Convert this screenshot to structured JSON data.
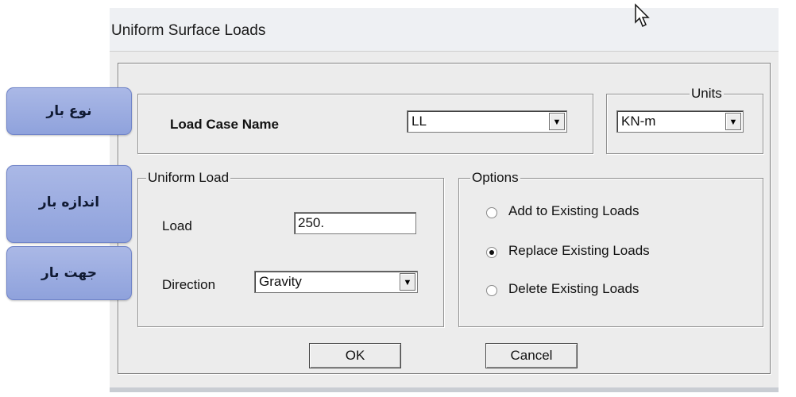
{
  "dialog": {
    "title": "Uniform Surface Loads",
    "load_case": {
      "label": "Load Case Name",
      "value": "LL"
    },
    "units": {
      "legend": "Units",
      "value": "KN-m"
    },
    "uniform_load": {
      "legend": "Uniform Load",
      "load_label": "Load",
      "load_value": "250.",
      "direction_label": "Direction",
      "direction_value": "Gravity"
    },
    "options": {
      "legend": "Options",
      "items": [
        {
          "label": "Add to Existing Loads",
          "selected": false
        },
        {
          "label": "Replace Existing Loads",
          "selected": true
        },
        {
          "label": "Delete Existing Loads",
          "selected": false
        }
      ]
    },
    "buttons": {
      "ok": "OK",
      "cancel": "Cancel"
    }
  },
  "annotations": {
    "load_type": "نوع بار",
    "load_magnitude": "اندازه بار",
    "load_direction": "جهت بار"
  },
  "colors": {
    "badge": "#9aaae0",
    "dialog_bg": "#ececec"
  }
}
